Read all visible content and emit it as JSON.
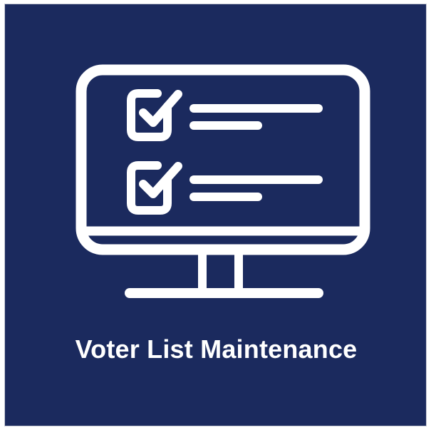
{
  "tile": {
    "background_color": "#1b2a5e",
    "foreground_color": "#ffffff",
    "icon": "computer-monitor-checklist-icon",
    "caption": "Voter List Maintenance"
  }
}
